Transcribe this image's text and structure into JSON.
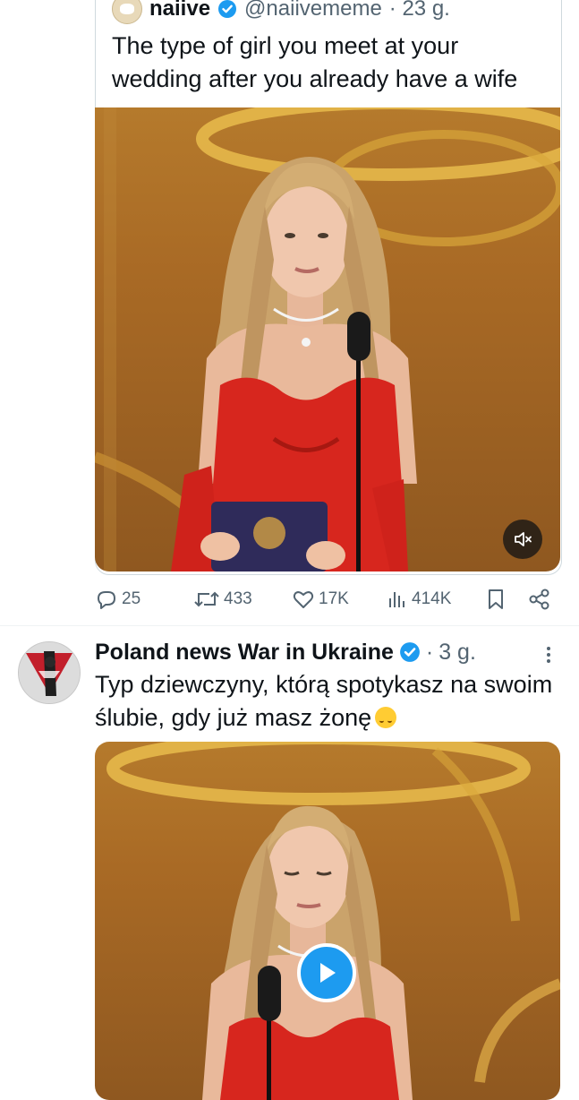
{
  "quoted_tweet": {
    "name": "naiive",
    "handle": "@naiivememe",
    "time": "· 23 g.",
    "text": "The type of girl you meet at your wedding after you already have a wife"
  },
  "metrics": {
    "replies": "25",
    "reposts": "433",
    "likes": "17K",
    "views": "414K"
  },
  "post": {
    "name": "Poland news War in Ukraine",
    "dot": "·",
    "time": "3 g.",
    "text": "Typ dziewczyny, którą spotykasz na swoim ślubie, gdy już masz żonę"
  },
  "icons": {
    "verified": "verified-badge-icon",
    "mute": "muted-speaker-icon",
    "reply": "reply-bubble-icon",
    "repost": "repost-arrows-icon",
    "like": "heart-icon",
    "views": "bar-chart-icon",
    "bookmark": "bookmark-icon",
    "share": "share-icon",
    "more": "vertical-dots-icon",
    "play": "play-icon",
    "emoji": "upside-down-face-emoji"
  },
  "colors": {
    "accent": "#1d9bf0",
    "secondary_text": "#536471",
    "dress_red": "#d7261e",
    "stage_gold": "#b57a2c"
  }
}
